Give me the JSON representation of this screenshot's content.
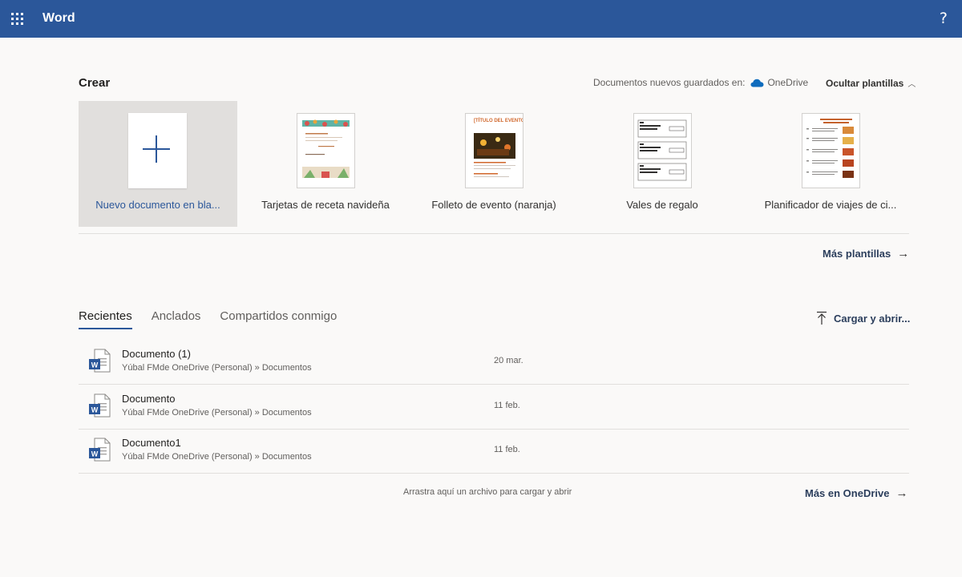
{
  "app": {
    "name": "Word",
    "help_label": "?"
  },
  "colors": {
    "brand": "#2b579a",
    "onedrive": "#0f6cbd"
  },
  "create": {
    "title": "Crear",
    "saved_in_label": "Documentos nuevos guardados en:",
    "saved_in_service": "OneDrive",
    "hide_templates_label": "Ocultar plantillas",
    "more_templates_label": "Más plantillas",
    "templates": [
      {
        "label": "Nuevo documento en bla..."
      },
      {
        "label": "Tarjetas de receta navideña"
      },
      {
        "label": "Folleto de evento (naranja)",
        "thumb_heading": "[TÍTULO DEL EVENTO]"
      },
      {
        "label": "Vales de regalo"
      },
      {
        "label": "Planificador de viajes de ci..."
      }
    ]
  },
  "recent": {
    "tabs": [
      {
        "label": "Recientes",
        "active": true
      },
      {
        "label": "Anclados"
      },
      {
        "label": "Compartidos conmigo"
      }
    ],
    "upload_label": "Cargar y abrir...",
    "files": [
      {
        "name": "Documento (1)",
        "path": "Yúbal FMde OneDrive (Personal) » Documentos",
        "date": "20 mar.",
        "icon": "word-doc-icon"
      },
      {
        "name": "Documento",
        "path": "Yúbal FMde OneDrive (Personal) » Documentos",
        "date": "11 feb.",
        "icon": "word-doc-icon"
      },
      {
        "name": "Documento1",
        "path": "Yúbal FMde OneDrive (Personal) » Documentos",
        "date": "11 feb.",
        "icon": "word-doc-icon"
      }
    ],
    "drag_hint": "Arrastra aquí un archivo para cargar y abrir",
    "more_onedrive_label": "Más en OneDrive"
  }
}
